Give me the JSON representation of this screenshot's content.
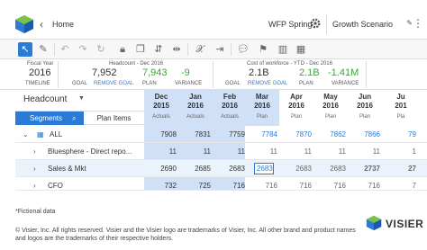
{
  "topbar": {
    "home_label": "Home",
    "workspace_label": "WFP Spring",
    "scenario_label": "Growth Scenario"
  },
  "kpis": {
    "fiscal_year": {
      "caption": "Fiscal Year",
      "value": "2016",
      "sub": "TIMELINE"
    },
    "headcount": {
      "caption": "Headcount - Dec 2016",
      "goal_value": "7,952",
      "plan_value": "7,943",
      "variance_value": "-9",
      "goal_label": "GOAL",
      "remove_goal_label": "REMOVE GOAL",
      "plan_label": "PLAN",
      "variance_label": "VARIANCE"
    },
    "cost": {
      "caption": "Cost of workforce - YTD - Dec 2016",
      "goal_value": "2.1B",
      "plan_value": "2.1B",
      "variance_value": "-1.41M",
      "goal_label": "GOAL",
      "remove_goal_label": "REMOVE GOAL",
      "plan_label": "PLAN",
      "variance_label": "VARIANCE"
    }
  },
  "grid": {
    "header_title": "Headcount",
    "segments_label": "Segments",
    "plan_items_label": "Plan Items",
    "columns": [
      {
        "month": "Dec",
        "year": "2015",
        "sub": "Actuals"
      },
      {
        "month": "Jan",
        "year": "2016",
        "sub": "Actuals"
      },
      {
        "month": "Feb",
        "year": "2016",
        "sub": "Actuals"
      },
      {
        "month": "Mar",
        "year": "2016",
        "sub": "Plan"
      },
      {
        "month": "Apr",
        "year": "2016",
        "sub": "Plan"
      },
      {
        "month": "May",
        "year": "2016",
        "sub": "Plan"
      },
      {
        "month": "Jun",
        "year": "2016",
        "sub": "Plan"
      },
      {
        "month": "Ju",
        "year": "201",
        "sub": "Pla"
      }
    ],
    "rows": [
      {
        "label": "ALL",
        "values": [
          "7908",
          "7831",
          "7759",
          "7784",
          "7870",
          "7862",
          "7866",
          "79"
        ]
      },
      {
        "label": "Bluesphere - Direct repo...",
        "values": [
          "11",
          "11",
          "11",
          "11",
          "11",
          "11",
          "11",
          "1"
        ]
      },
      {
        "label": "Sales & Mkt",
        "values": [
          "2690",
          "2685",
          "2683",
          "2683",
          "2683",
          "2683",
          "2737",
          "27"
        ]
      },
      {
        "label": "CFO",
        "values": [
          "732",
          "725",
          "716",
          "716",
          "716",
          "716",
          "716",
          "7"
        ]
      }
    ]
  },
  "footer": {
    "footnote": "*Fictional data",
    "copyright": "© Visier, Inc. All rights reserved. Visier and the Visier logo are trademarks of Visier, Inc. All other brand and product names and logos are the trademarks of their respective holders.",
    "brand": "VISIER"
  },
  "colors": {
    "accent": "#2b7bd6",
    "selection": "#cfe0f7",
    "positive": "#3aa835"
  }
}
